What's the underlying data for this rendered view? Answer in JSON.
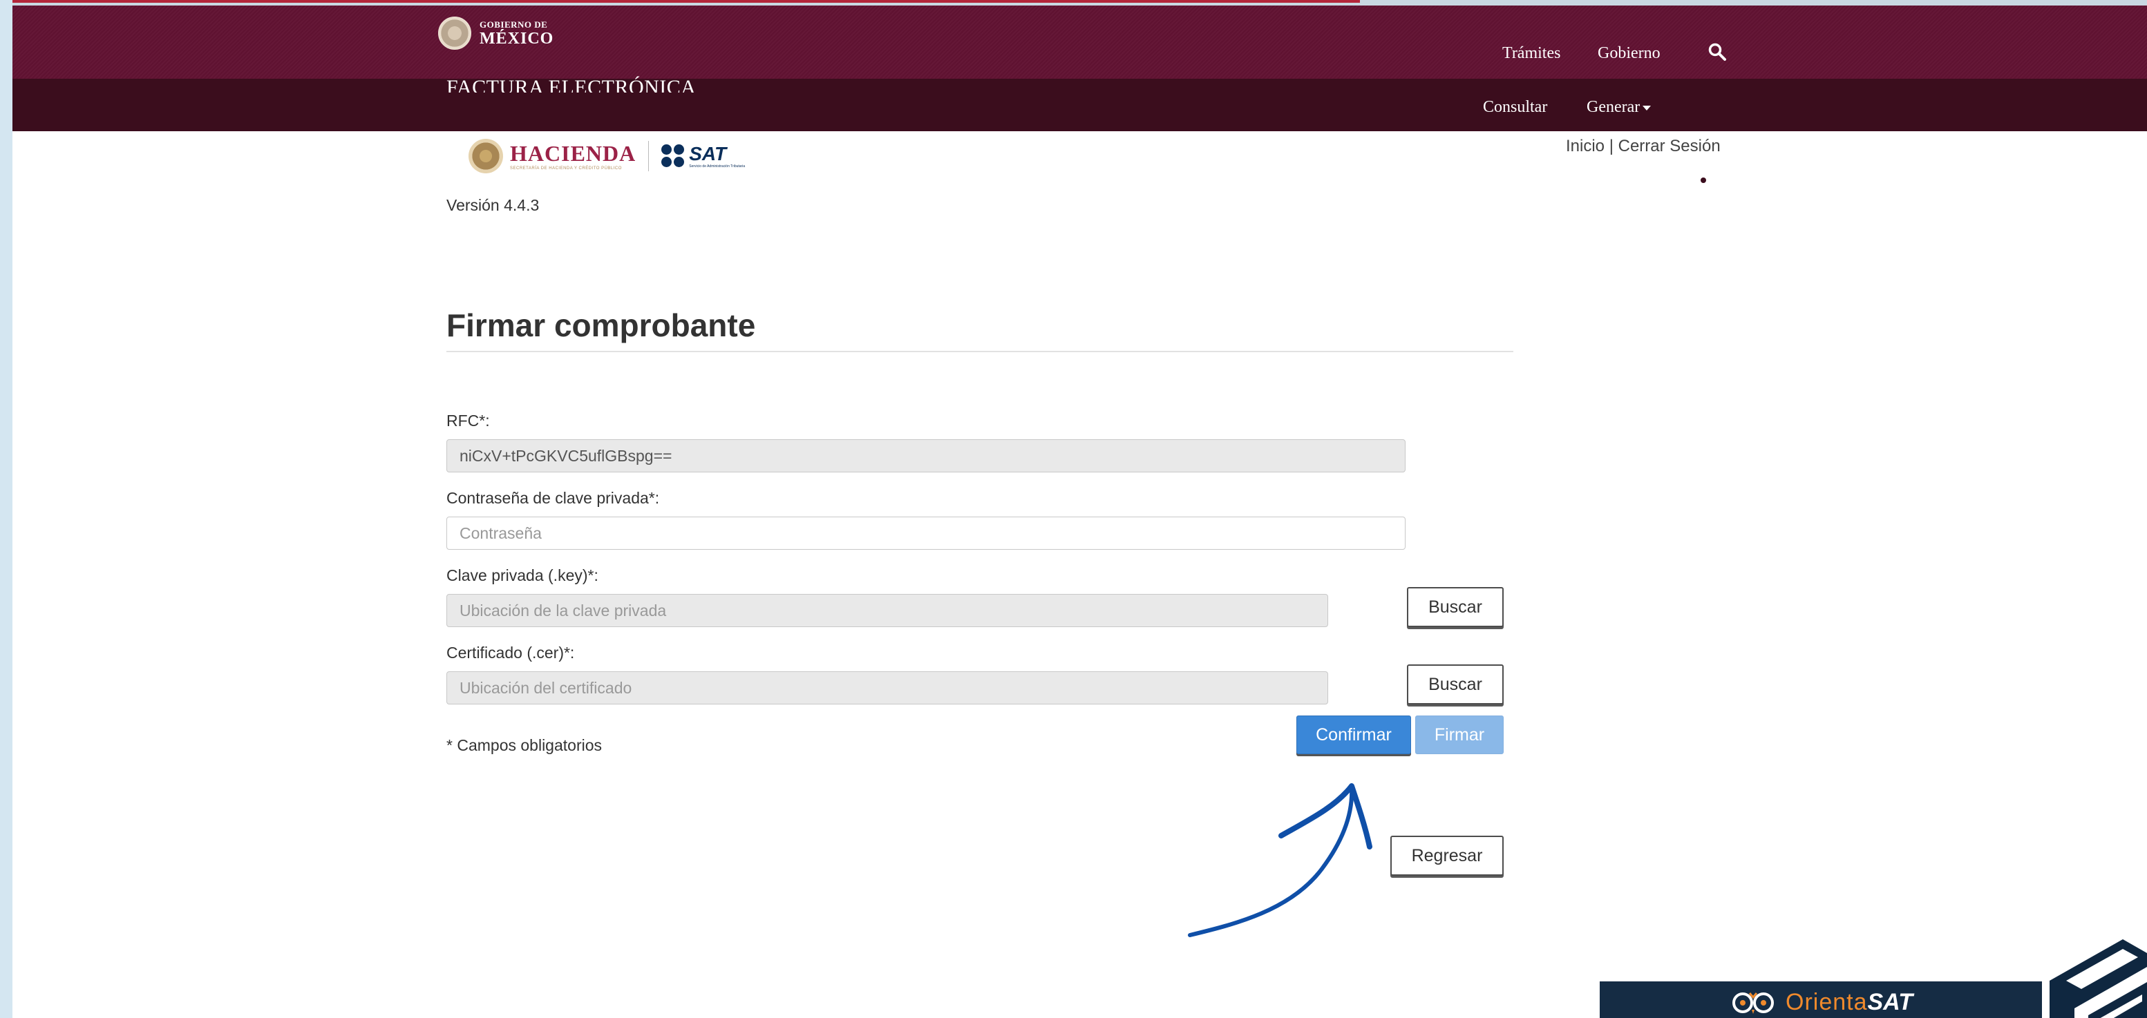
{
  "header": {
    "gov_small": "GOBIERNO DE",
    "gov_big": "MÉXICO",
    "links": [
      "Trámites",
      "Gobierno"
    ],
    "section_title": "FACTURA ELECTRÓNICA",
    "subnav": {
      "consultar": "Consultar",
      "generar": "Generar"
    }
  },
  "logos": {
    "hacienda": "HACIENDA",
    "hacienda_sub": "SECRETARÍA DE HACIENDA Y CRÉDITO PÚBLICO",
    "sat": "SAT",
    "sat_sub": "Servicio de Administración Tributaria"
  },
  "session": {
    "inicio": "Inicio",
    "separator": "|",
    "cerrar": "Cerrar Sesión"
  },
  "version": "Versión 4.4.3",
  "form": {
    "title": "Firmar comprobante",
    "rfc_label": "RFC*:",
    "rfc_value": "niCxV+tPcGKVC5uflGBspg==",
    "password_label": "Contraseña de clave privada*:",
    "password_placeholder": "Contraseña",
    "key_label": "Clave privada (.key)*:",
    "key_placeholder": "Ubicación de la clave privada",
    "cert_label": "Certificado (.cer)*:",
    "cert_placeholder": "Ubicación del certificado",
    "buscar": "Buscar",
    "required_note": "* Campos obligatorios",
    "confirmar": "Confirmar",
    "firmar": "Firmar",
    "regresar": "Regresar"
  },
  "badge": {
    "orienta": "Orienta",
    "sat": "SAT"
  },
  "colors": {
    "navbar": "#611232",
    "subnav": "#3b0d1d",
    "primary": "#3a87d8",
    "primary_disabled": "#8ab8e8",
    "annotation_arrow": "#0f4fa8",
    "badge_bg": "#152c44",
    "badge_accent": "#f08a2c"
  },
  "icons": {
    "search": "search-icon",
    "settings": "gear-icon",
    "dropdown": "caret-down-icon",
    "annotation": "arrow-annotation-icon",
    "badge": "owl-icon"
  }
}
